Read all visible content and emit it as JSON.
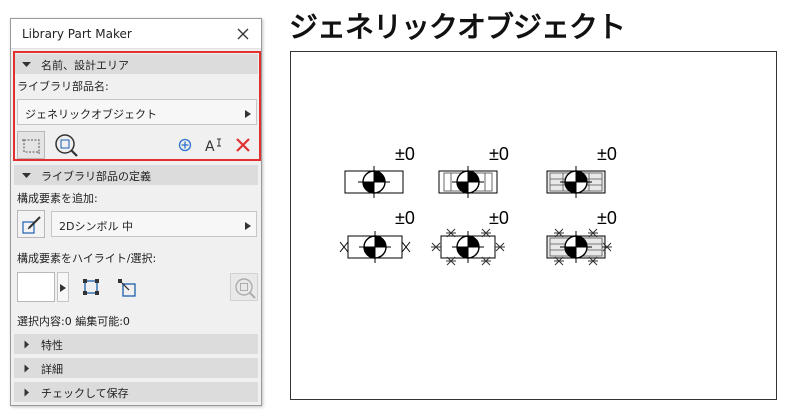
{
  "window": {
    "title": "Library Part Maker",
    "close_icon": "close-icon"
  },
  "name_section": {
    "header": "名前、設計エリア",
    "name_label": "ライブラリ部品名:",
    "name_value": "ジェネリックオブジェクト"
  },
  "toolbar": {
    "select_area_icon": "marquee-icon",
    "zoom_area_icon": "zoom-icon",
    "add_icon": "plus-circle-icon",
    "text_icon": "text-cursor-icon",
    "delete_icon": "delete-x-icon"
  },
  "definition_section": {
    "header": "ライブラリ部品の定義",
    "add_label": "構成要素を追加:",
    "element_value": "2Dシンボル 中",
    "highlight_label": "構成要素をハイライト/選択:",
    "status_text": "選択内容:0 編集可能:0"
  },
  "collapsed_sections": [
    "特性",
    "詳細",
    "チェックして保存"
  ],
  "preview": {
    "title": "ジェネリックオブジェクト",
    "elevation_labels": [
      "±0",
      "±0",
      "±0",
      "±0",
      "±0",
      "±0"
    ]
  },
  "colors": {
    "accent_red": "#e03030",
    "add_blue": "#2a72d0",
    "panel_bg": "#f0f0f0",
    "header_bg": "#dcdcdc"
  }
}
